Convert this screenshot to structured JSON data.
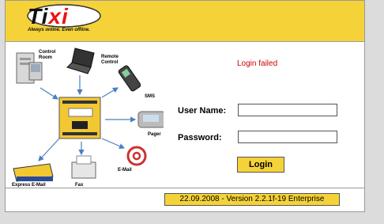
{
  "brand": {
    "name_part1": "Ti",
    "name_part2": "xi",
    "tagline": "Always online. Even offline."
  },
  "diagram": {
    "control_room": "Control Room",
    "remote_control": "Remote Control",
    "sms": "SMS",
    "pager": "Pager",
    "email": "E-Mail",
    "fax": "Fax",
    "express_email": "Express E-Mail"
  },
  "login": {
    "error_message": "Login failed",
    "username_label": "User Name:",
    "password_label": "Password:",
    "username_value": "",
    "password_value": "",
    "submit_label": "Login"
  },
  "footer": {
    "version": "22.09.2008 - Version 2.2.1f-19 Enterprise"
  },
  "colors": {
    "header_bg": "#f5d338",
    "error": "#cc0000",
    "accent_arrows": "#4a7fc1"
  }
}
